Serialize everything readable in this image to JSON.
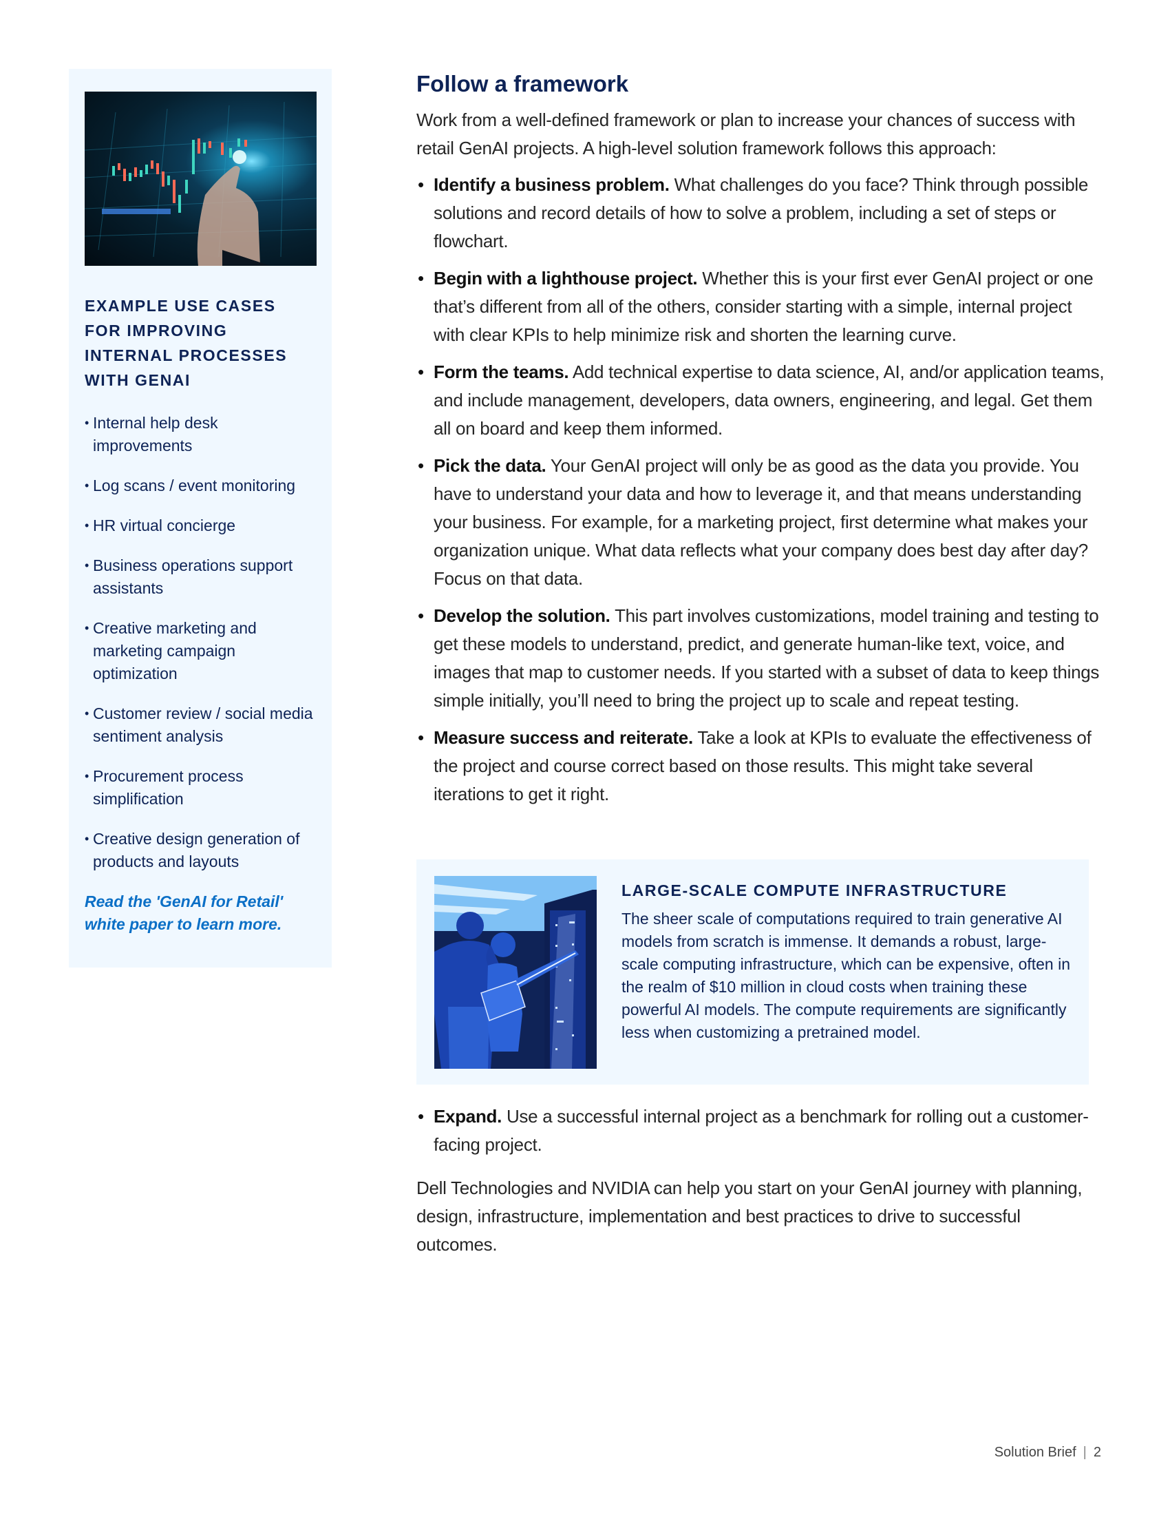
{
  "sidebar": {
    "photo_label": "Hand touching holographic stock chart",
    "heading": "Example use cases for improving internal processes with GenAI",
    "use_cases": [
      {
        "text": "Internal help desk improvements"
      },
      {
        "text": "Log scans / event monitoring"
      },
      {
        "text": "HR virtual concierge"
      },
      {
        "text": "Business operations support assistants"
      },
      {
        "text": "Creative marketing and marketing campaign optimization"
      },
      {
        "text": "Customer review / social media sentiment analysis"
      },
      {
        "text": "Procurement process simplification"
      },
      {
        "text": "Creative design generation of products and layouts"
      }
    ],
    "link_text": "Read the 'GenAI for Retail' white paper to learn more.",
    "bullet": "•"
  },
  "main": {
    "title": "Follow a framework",
    "intro": "Work from a well-defined framework or plan to increase your chances of success with retail GenAI projects. A high-level solution framework follows this approach:",
    "bullet": "•",
    "steps": [
      {
        "title": "Identify a business problem.",
        "text": " What challenges do you face? Think through possible solutions and record details of how to solve a problem, including a set of steps or flowchart."
      },
      {
        "title": "Begin with a lighthouse project.",
        "text": " Whether this is your first ever GenAI project or one that’s different from all of the others, consider starting with a simple, internal project with clear KPIs to help minimize risk and shorten the learning curve."
      },
      {
        "title": "Form the teams.",
        "text": " Add technical expertise to data science, AI, and/or application teams, and include management, developers, data owners, engineering, and legal. Get them all on board and keep them informed."
      },
      {
        "title": "Pick the data.",
        "text": " Your GenAI project will only be as good as the data you provide. You have to understand your data and how to leverage it, and that means understanding your business. For example, for a marketing project, first determine what makes your organization unique. What data reflects what your company does best day after day? Focus on that data."
      },
      {
        "title": "Develop the solution.",
        "text": " This part involves customizations, model training and testing to get these models to understand, predict, and generate human-like text, voice, and images that map to customer needs. If you started with a subset of data to keep things simple initially, you’ll need to bring the project up to scale and repeat testing."
      },
      {
        "title": "Measure success and reiterate.",
        "text": " Take a look at KPIs to evaluate the effectiveness of the project and course correct based on those results. This might take several iterations to get it right."
      }
    ],
    "expand_step": {
      "title": "Expand.",
      "text": " Use a successful internal project as a benchmark for rolling out a customer-facing project."
    },
    "closing": "Dell Technologies and NVIDIA can help you start on your GenAI journey with planning, design, infrastructure, implementation and best practices to drive to successful outcomes."
  },
  "callout": {
    "art_label": "Two people inspecting a server rack",
    "heading": "Large-scale compute infrastructure",
    "body": "The sheer scale of computations required to train generative AI models from scratch is immense. It demands a robust, large-scale computing infrastructure, which can be expensive, often in the realm of $10 million in cloud costs when training these powerful AI models. The compute requirements are significantly less when customizing a pretrained model."
  },
  "footer": {
    "label": "Solution Brief",
    "separator": "|",
    "page_number": "2"
  },
  "colors": {
    "navy": "#0e2356",
    "link_blue": "#0b6fc6",
    "panel_bg": "#f0f8ff",
    "body_text": "#262626"
  }
}
